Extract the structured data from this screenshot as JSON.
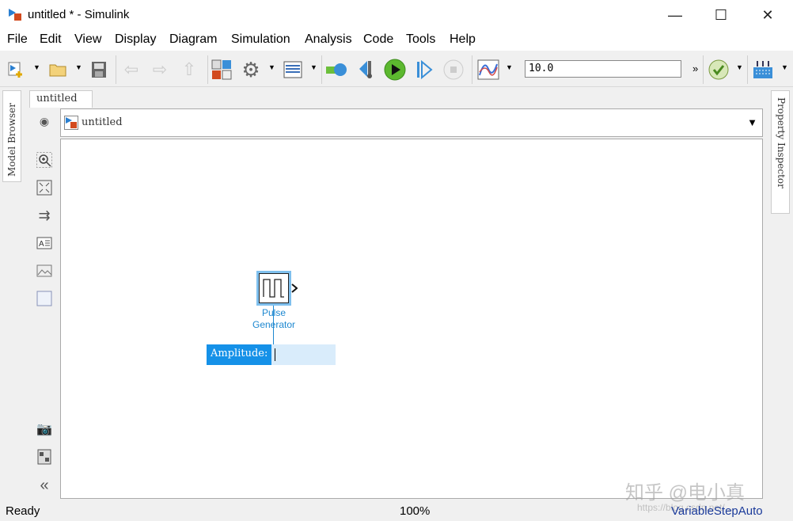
{
  "window": {
    "title": "untitled * - Simulink",
    "minimize": "—",
    "maximize": "☐",
    "close": "✕"
  },
  "menu": [
    "File",
    "Edit",
    "View",
    "Display",
    "Diagram",
    "Simulation",
    "Analysis",
    "Code",
    "Tools",
    "Help"
  ],
  "toolbar": {
    "stop_time": "10.0",
    "more": "»"
  },
  "side_tabs": {
    "left": "Model Browser",
    "right": "Property Inspector"
  },
  "doc_tab": "untitled",
  "address": {
    "path": "untitled"
  },
  "block": {
    "name_line1": "Pulse",
    "name_line2": "Generator",
    "param_label": "Amplitude:",
    "param_value": ""
  },
  "status": {
    "left": "Ready",
    "zoom": "100%",
    "solver": "VariableStepAuto"
  },
  "watermark": {
    "text": "知乎 @电小真",
    "url": "https://blog.csdn.net/..."
  },
  "colors": {
    "accent": "#1591e8",
    "selection": "#7fc0ee"
  }
}
